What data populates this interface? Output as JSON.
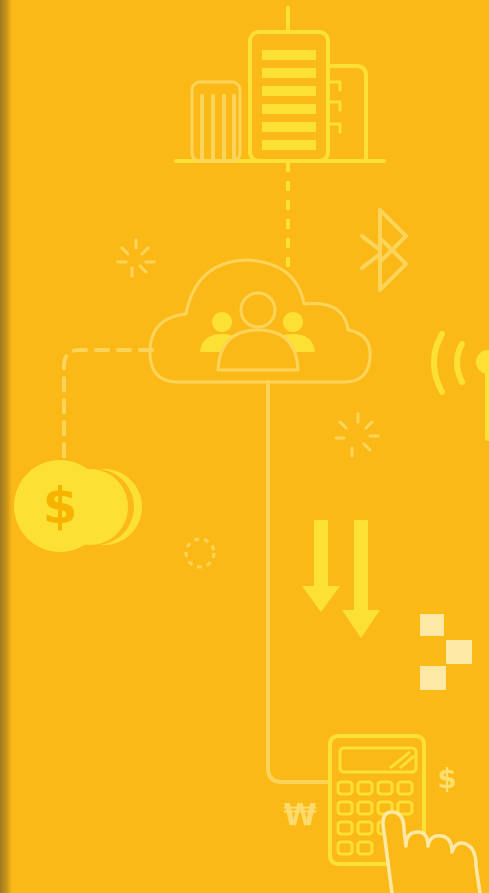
{
  "illustration": {
    "background_color": "#FBB917",
    "accent_color": "#FDE034",
    "line_color": "#FCD45A",
    "icons": [
      "office-buildings-icon",
      "bluetooth-icon",
      "cloud-users-icon",
      "wireless-tower-icon",
      "coins-icon",
      "download-arrows-icon",
      "pixel-blocks-icon",
      "calculator-icon",
      "pointing-hand-icon"
    ],
    "currency": {
      "coin": "$",
      "won": "₩",
      "dollar": "$"
    }
  }
}
